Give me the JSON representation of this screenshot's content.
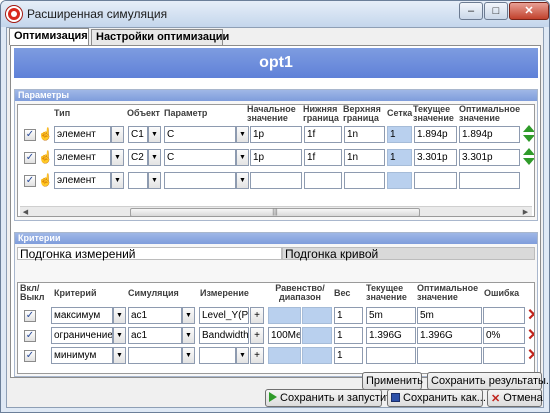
{
  "window": {
    "title": "Расширенная симуляция",
    "min": "–",
    "max": "□",
    "close": "✕"
  },
  "tabs": [
    "Оптимизация",
    "Настройки оптимизации"
  ],
  "opt_name": "opt1",
  "params": {
    "group_title": "Параметры",
    "headers": {
      "type": "Тип",
      "object": "Объект",
      "param": "Параметр",
      "start": "Начальное значение",
      "lower": "Нижняя граница",
      "upper": "Верхняя граница",
      "grid": "Сетка",
      "current": "Текущее значение",
      "optimal": "Оптимальное значение"
    },
    "rows": [
      {
        "checked": true,
        "type": "элемент",
        "object": "C1",
        "param": "C",
        "start": "1p",
        "lower": "1f",
        "upper": "1n",
        "grid": "1",
        "current": "1.894p",
        "optimal": "1.894p"
      },
      {
        "checked": true,
        "type": "элемент",
        "object": "C2",
        "param": "C",
        "start": "1p",
        "lower": "1f",
        "upper": "1n",
        "grid": "1",
        "current": "3.301p",
        "optimal": "3.301p"
      },
      {
        "checked": true,
        "type": "элемент",
        "object": "",
        "param": "",
        "start": "",
        "lower": "",
        "upper": "",
        "grid": "",
        "current": "",
        "optimal": ""
      }
    ]
  },
  "criteria": {
    "group_title": "Критерии",
    "subtabs": [
      "Подгонка измерений",
      "Подгонка кривой"
    ],
    "headers": {
      "on": "Вкл/ Выкл",
      "criterion": "Критерий",
      "sim": "Симуляция",
      "measure": "Измерение",
      "eq": "Равенство/ диапазон",
      "weight": "Вес",
      "current": "Текущее значение",
      "optimal": "Оптимальное значение",
      "error": "Ошибка"
    },
    "rows": [
      {
        "checked": true,
        "criterion": "максимум",
        "sim": "ac1",
        "measure": "Level_Y(PD",
        "eq": "",
        "weight": "1",
        "current": "5m",
        "optimal": "5m",
        "error": ""
      },
      {
        "checked": true,
        "criterion": "ограничение",
        "sim": "ac1",
        "measure": "Bandwidth(",
        "eq": "100Me",
        "weight": "1",
        "current": "1.396G",
        "optimal": "1.396G",
        "error": "0%"
      },
      {
        "checked": true,
        "criterion": "минимум",
        "sim": "",
        "measure": "",
        "eq": "",
        "weight": "1",
        "current": "",
        "optimal": "",
        "error": ""
      }
    ]
  },
  "buttons": {
    "apply": "Применить",
    "save_results": "Сохранить результаты...",
    "save_run": "Сохранить и запустить",
    "save_as": "Сохранить как...",
    "cancel": "Отмена"
  }
}
